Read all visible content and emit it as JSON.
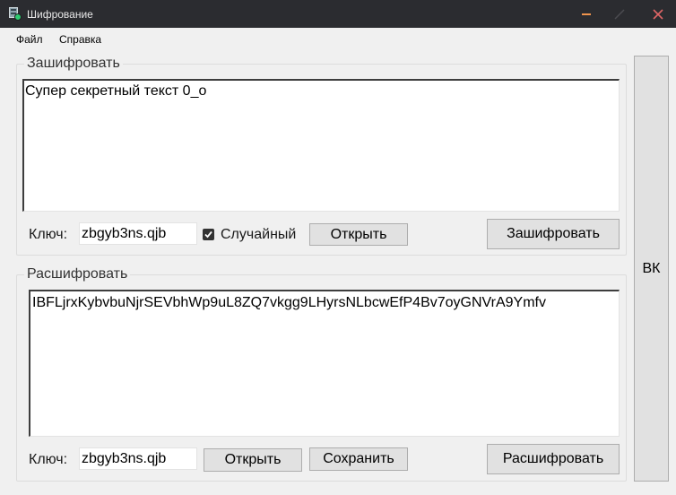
{
  "window": {
    "title": "Шифрование",
    "controls": [
      "minimize-icon",
      "maximize-icon",
      "close-icon"
    ],
    "accent_colors": {
      "minimize": "#f0944d",
      "maximize": "#4b4c50",
      "close": "#e06666",
      "titlebar": "#2b2c30"
    }
  },
  "menu": {
    "file": "Файл",
    "help": "Справка"
  },
  "encrypt": {
    "title": "Зашифровать",
    "text": "Супер секретный текст 0_о",
    "key_label": "Ключ:",
    "key_value": "zbgyb3ns.qjb",
    "random_label": "Случайный",
    "random_checked": true,
    "open_label": "Открыть",
    "action_label": "Зашифровать"
  },
  "decrypt": {
    "title": "Расшифровать",
    "text": "IBFLjrxKybvbuNjrSEVbhWp9uL8ZQ7vkgg9LHyrsNLbcwEfP4Bv7oyGNVrA9Ymfv",
    "key_label": "Ключ:",
    "key_value": "zbgyb3ns.qjb",
    "open_label": "Открыть",
    "save_label": "Сохранить",
    "action_label": "Расшифровать"
  },
  "side": {
    "vk_label": "ВК"
  }
}
